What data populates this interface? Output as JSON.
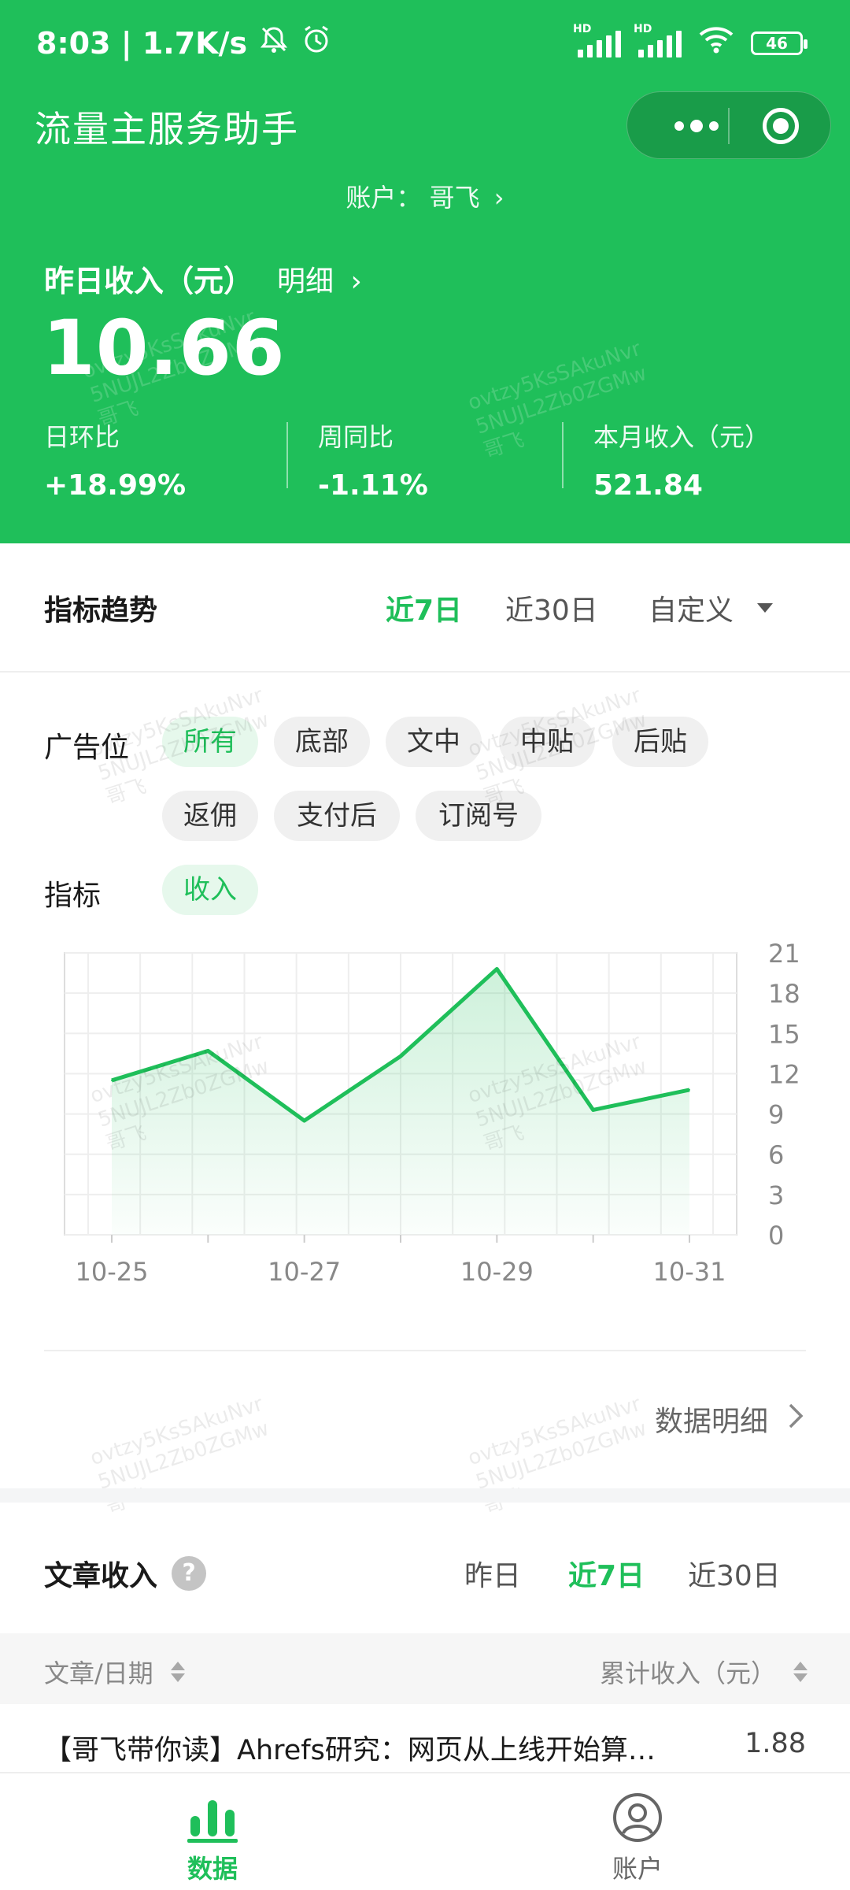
{
  "status_bar": {
    "time_speed": "8:03 | 1.7K/s",
    "battery": "46",
    "hd1": "HD",
    "hd2": "HD"
  },
  "app": {
    "title": "流量主服务助手",
    "account_label": "账户：",
    "account_name": "哥飞",
    "chevron": "›"
  },
  "summary": {
    "income_label": "昨日收入（元）",
    "detail_link": "明细",
    "income_value": "10.66",
    "stats": [
      {
        "label": "日环比",
        "value": "+18.99%"
      },
      {
        "label": "周同比",
        "value": "-1.11%"
      },
      {
        "label": "本月收入（元）",
        "value": "521.84"
      }
    ]
  },
  "trend": {
    "title": "指标趋势",
    "ranges": [
      "近7日",
      "近30日",
      "自定义"
    ],
    "active_range": "近7日"
  },
  "filters": {
    "ad_position_label": "广告位",
    "ad_positions": [
      "所有",
      "底部",
      "文中",
      "中贴",
      "后贴",
      "返佣",
      "支付后",
      "订阅号"
    ],
    "active_position": "所有",
    "metric_label": "指标",
    "metrics": [
      "收入"
    ],
    "active_metric": "收入"
  },
  "chart_data": {
    "type": "area",
    "x": [
      "10-25",
      "10-26",
      "10-27",
      "10-28",
      "10-29",
      "10-30",
      "10-31"
    ],
    "x_tick_labels": [
      "10-25",
      "10-27",
      "10-29",
      "10-31"
    ],
    "values": [
      11.5,
      13.7,
      8.5,
      13.3,
      19.8,
      9.3,
      10.8
    ],
    "y_ticks": [
      0,
      3,
      6,
      9,
      12,
      15,
      18,
      21
    ],
    "ylim": [
      0,
      21
    ],
    "y_axis_side": "right",
    "grid": true,
    "color": "#1fbf5a"
  },
  "data_detail_link": "数据明细",
  "article_income": {
    "title": "文章收入",
    "help_icon": "?",
    "ranges": [
      "昨日",
      "近7日",
      "近30日"
    ],
    "active_range": "近7日",
    "columns": [
      "文章/日期",
      "累计收入（元）"
    ],
    "rows": [
      {
        "title": "【哥飞带你读】Ahrefs研究：网页从上线开始算…",
        "value": "1.88"
      }
    ]
  },
  "tabbar": {
    "tabs": [
      "数据",
      "账户"
    ],
    "active": "数据"
  },
  "watermark": {
    "line1": "ovtzy5KsSAkuNvr",
    "line2": "5NUJL2Zb0ZGMw",
    "line3": "哥飞"
  },
  "colors": {
    "brand_green": "#1fbf5a",
    "chip_active_bg": "#e6f8ec"
  }
}
